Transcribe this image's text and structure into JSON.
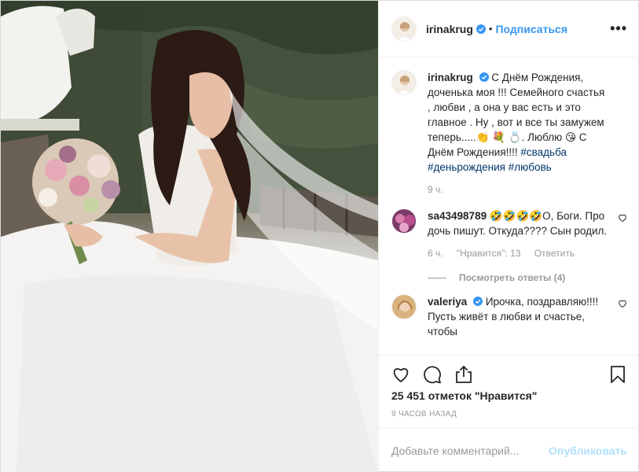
{
  "header": {
    "username": "irinakrug",
    "dot": "•",
    "follow_label": "Подписаться",
    "more_label": "•••"
  },
  "caption": {
    "username": "irinakrug",
    "text": "С Днём Рождения, доченька моя !!! Семейного счастья , любви , а она у вас есть и это главное . Ну , вот и все ты замужем теперь.....👏 💐 💍. Люблю 😘 С Днём Рождения!!!! ",
    "tags": [
      "#свадьба",
      "#деньрождения",
      "#любовь"
    ],
    "time": "9 ч."
  },
  "comments": [
    {
      "username": "sa43498789",
      "text": "🤣🤣🤣🤣О, Боги. Про дочь пишут. Откуда???? Сын родил.",
      "time": "6 ч.",
      "likes": "\"Нравится\": 13",
      "reply_label": "Ответить",
      "view_replies": "Посмотреть ответы (4)"
    },
    {
      "username": "valeriya",
      "text": "Ирочка, поздравляю!!!! Пусть живёт в любви и счастье, чтобы"
    }
  ],
  "actions": {
    "icons": [
      "heart-icon",
      "comment-icon",
      "share-icon",
      "bookmark-icon"
    ]
  },
  "likes_text": "25 451 отметок \"Нравится\"",
  "timestamp": "9 ЧАСОВ НАЗАД",
  "composer": {
    "placeholder": "Добавьте комментарий...",
    "publish_label": "Опубликовать"
  },
  "colors": {
    "link_blue": "#3897f0",
    "publish_disabled": "#b2dffc",
    "hashtag": "#003569",
    "muted": "#999999"
  }
}
